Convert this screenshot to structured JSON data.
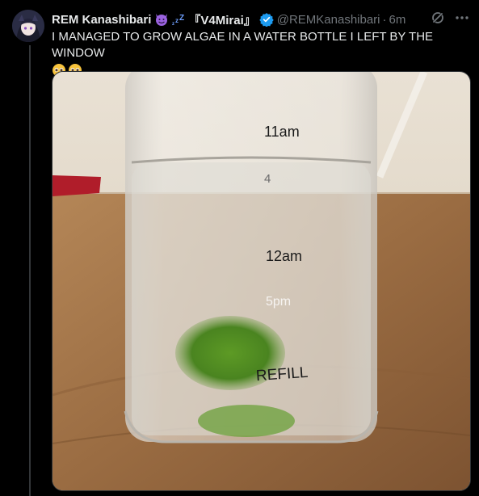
{
  "tweet": {
    "author": {
      "display_name": "REM Kanashibari",
      "badge_emojis": [
        "smiling-devil-emoji",
        "zzz-emoji"
      ],
      "tag": "『V4Mirai』",
      "handle": "@REMKanashibari",
      "verified": true
    },
    "separator": "·",
    "time": "6m",
    "text": "I MANAGED TO GROW ALGAE IN A WATER BOTTLE I LEFT BY THE WINDOW",
    "text_emojis": [
      "pleading-face-emoji",
      "pleading-face-emoji"
    ],
    "media": {
      "bottle_markings": [
        "11am",
        "4",
        "12am",
        "5pm",
        "REFILL"
      ]
    }
  },
  "colors": {
    "background": "#000000",
    "text": "#e7e9ea",
    "muted": "#71767b",
    "verified": "#1d9bf0",
    "algae": "#4f8a1f"
  }
}
